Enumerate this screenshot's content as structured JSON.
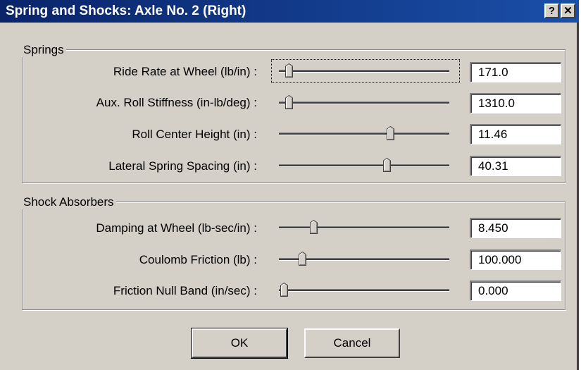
{
  "window": {
    "title": "Spring and Shocks:  Axle No. 2 (Right)",
    "help_label": "?",
    "close_label": "✕"
  },
  "springs": {
    "title": "Springs",
    "rows": [
      {
        "label": "Ride Rate at Wheel (lb/in) :",
        "value": "171.0",
        "slider_level": 0.03
      },
      {
        "label": "Aux. Roll Stiffness (in-lb/deg) :",
        "value": "1310.0",
        "slider_level": 0.03
      },
      {
        "label": "Roll Center Height (in) :",
        "value": "11.46",
        "slider_level": 0.64
      },
      {
        "label": "Lateral Spring Spacing (in) :",
        "value": "40.31",
        "slider_level": 0.62
      }
    ]
  },
  "shocks": {
    "title": "Shock Absorbers",
    "rows": [
      {
        "label": "Damping at Wheel (lb-sec/in) :",
        "value": "8.450",
        "slider_level": 0.18
      },
      {
        "label": "Coulomb Friction (lb) :",
        "value": "100.000",
        "slider_level": 0.11
      },
      {
        "label": "Friction Null Band (in/sec) :",
        "value": "0.000",
        "slider_level": 0.0
      }
    ]
  },
  "buttons": {
    "ok_label": "OK",
    "cancel_label": "Cancel"
  },
  "colors": {
    "titlebar": "#0a246a",
    "face": "#d4d0c8"
  }
}
